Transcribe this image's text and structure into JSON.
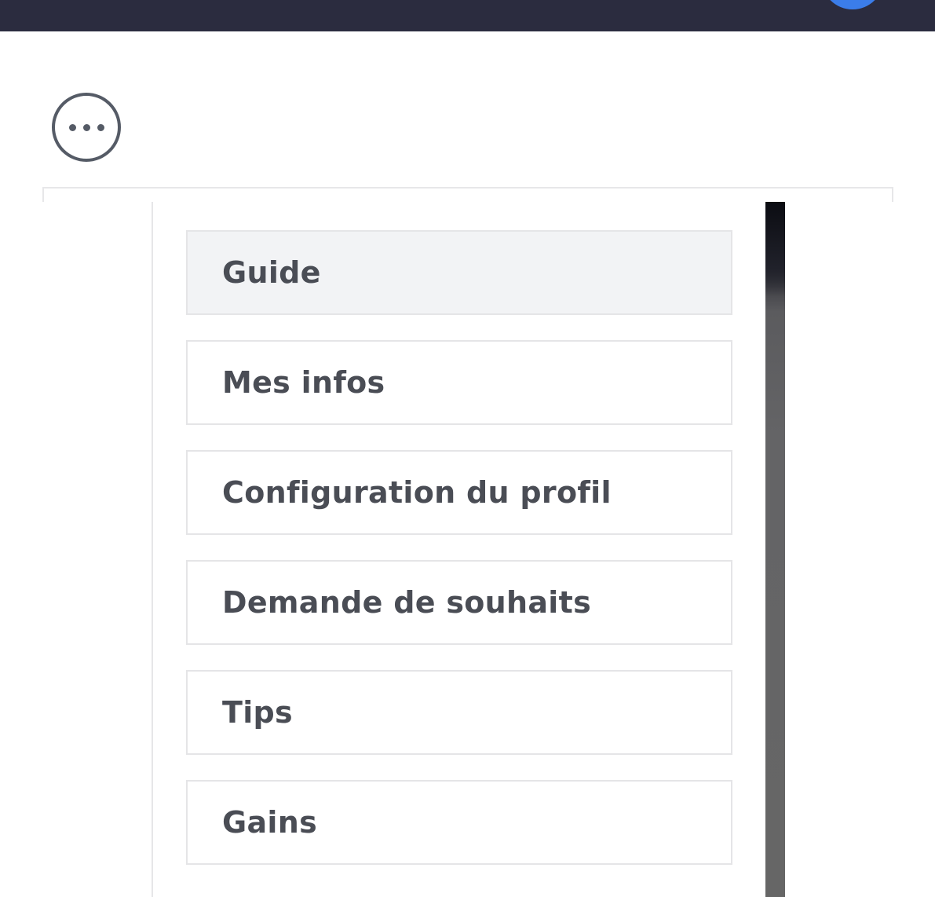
{
  "colors": {
    "topbar": "#2b2c3f",
    "accent": "#3b7de9",
    "menu_text": "#4a4d55",
    "active_item_bg": "#f2f3f5",
    "item_border": "#e5e5e7",
    "icon": "#555b66"
  },
  "header": {
    "more_icon": "more-horizontal-icon"
  },
  "menu": {
    "active_index": 0,
    "items": [
      {
        "label": "Guide"
      },
      {
        "label": "Mes infos"
      },
      {
        "label": "Configuration du profil"
      },
      {
        "label": "Demande de souhaits"
      },
      {
        "label": "Tips"
      },
      {
        "label": "Gains"
      }
    ]
  }
}
